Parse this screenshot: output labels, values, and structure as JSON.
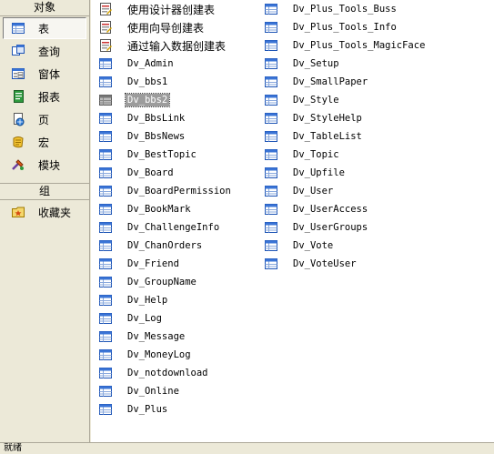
{
  "sidebar": {
    "objects_header": "对象",
    "groups_header": "组",
    "items": [
      {
        "label": "表",
        "icon": "table-icon",
        "selected": true
      },
      {
        "label": "查询",
        "icon": "query-icon",
        "selected": false
      },
      {
        "label": "窗体",
        "icon": "form-icon",
        "selected": false
      },
      {
        "label": "报表",
        "icon": "report-icon",
        "selected": false
      },
      {
        "label": "页",
        "icon": "page-icon",
        "selected": false
      },
      {
        "label": "宏",
        "icon": "macro-icon",
        "selected": false
      },
      {
        "label": "模块",
        "icon": "module-icon",
        "selected": false
      }
    ],
    "groups": [
      {
        "label": "收藏夹",
        "icon": "favorites-folder-icon"
      }
    ]
  },
  "list": {
    "column1": [
      {
        "text": "使用设计器创建表",
        "kind": "wizard"
      },
      {
        "text": "使用向导创建表",
        "kind": "wizard"
      },
      {
        "text": "通过输入数据创建表",
        "kind": "wizard"
      },
      {
        "text": "Dv_Admin",
        "kind": "table"
      },
      {
        "text": "Dv_bbs1",
        "kind": "table"
      },
      {
        "text": "Dv_bbs2",
        "kind": "table",
        "selected": true
      },
      {
        "text": "Dv_BbsLink",
        "kind": "table"
      },
      {
        "text": "Dv_BbsNews",
        "kind": "table"
      },
      {
        "text": "Dv_BestTopic",
        "kind": "table"
      },
      {
        "text": "Dv_Board",
        "kind": "table"
      },
      {
        "text": "Dv_BoardPermission",
        "kind": "table"
      },
      {
        "text": "Dv_BookMark",
        "kind": "table"
      },
      {
        "text": "Dv_ChallengeInfo",
        "kind": "table"
      },
      {
        "text": "DV_ChanOrders",
        "kind": "table"
      },
      {
        "text": "Dv_Friend",
        "kind": "table"
      },
      {
        "text": "Dv_GroupName",
        "kind": "table"
      },
      {
        "text": "Dv_Help",
        "kind": "table"
      },
      {
        "text": "Dv_Log",
        "kind": "table"
      },
      {
        "text": "Dv_Message",
        "kind": "table"
      },
      {
        "text": "Dv_MoneyLog",
        "kind": "table"
      },
      {
        "text": "Dv_notdownload",
        "kind": "table"
      },
      {
        "text": "Dv_Online",
        "kind": "table"
      },
      {
        "text": "Dv_Plus",
        "kind": "table"
      }
    ],
    "column2": [
      {
        "text": "Dv_Plus_Tools_Buss",
        "kind": "table"
      },
      {
        "text": "Dv_Plus_Tools_Info",
        "kind": "table"
      },
      {
        "text": "Dv_Plus_Tools_MagicFace",
        "kind": "table"
      },
      {
        "text": "Dv_Setup",
        "kind": "table"
      },
      {
        "text": "Dv_SmallPaper",
        "kind": "table"
      },
      {
        "text": "Dv_Style",
        "kind": "table"
      },
      {
        "text": "Dv_StyleHelp",
        "kind": "table"
      },
      {
        "text": "Dv_TableList",
        "kind": "table"
      },
      {
        "text": "Dv_Topic",
        "kind": "table"
      },
      {
        "text": "Dv_Upfile",
        "kind": "table"
      },
      {
        "text": "Dv_User",
        "kind": "table"
      },
      {
        "text": "Dv_UserAccess",
        "kind": "table"
      },
      {
        "text": "Dv_UserGroups",
        "kind": "table"
      },
      {
        "text": "Dv_Vote",
        "kind": "table"
      },
      {
        "text": "Dv_VoteUser",
        "kind": "table"
      }
    ]
  },
  "status": {
    "text": "就绪"
  }
}
